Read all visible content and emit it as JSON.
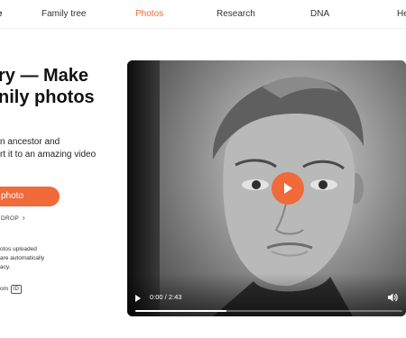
{
  "nav": {
    "logo_fragment": "e",
    "items": [
      {
        "label": "Family tree",
        "active": false
      },
      {
        "label": "Photos",
        "active": true
      },
      {
        "label": "Research",
        "active": false
      },
      {
        "label": "DNA",
        "active": false
      },
      {
        "label": "He",
        "active": false
      }
    ]
  },
  "hero": {
    "title_lines": [
      "ry — Make",
      "nily photos"
    ],
    "subtitle_lines": [
      "n ancestor and",
      "rt it to an amazing video"
    ],
    "cta_label": "photo",
    "drop_label": "DROP",
    "privacy_lines": [
      "otos uploaded",
      "are automatically",
      "acy."
    ],
    "badge_text": "om",
    "badge_id": "ID"
  },
  "video": {
    "time": "0:00 / 2:43",
    "progress": 0.34
  },
  "colors": {
    "accent": "#f06a3a"
  },
  "icons": {
    "play": "play-icon",
    "volume": "volume-icon",
    "chevron": "chevron-right-icon"
  }
}
